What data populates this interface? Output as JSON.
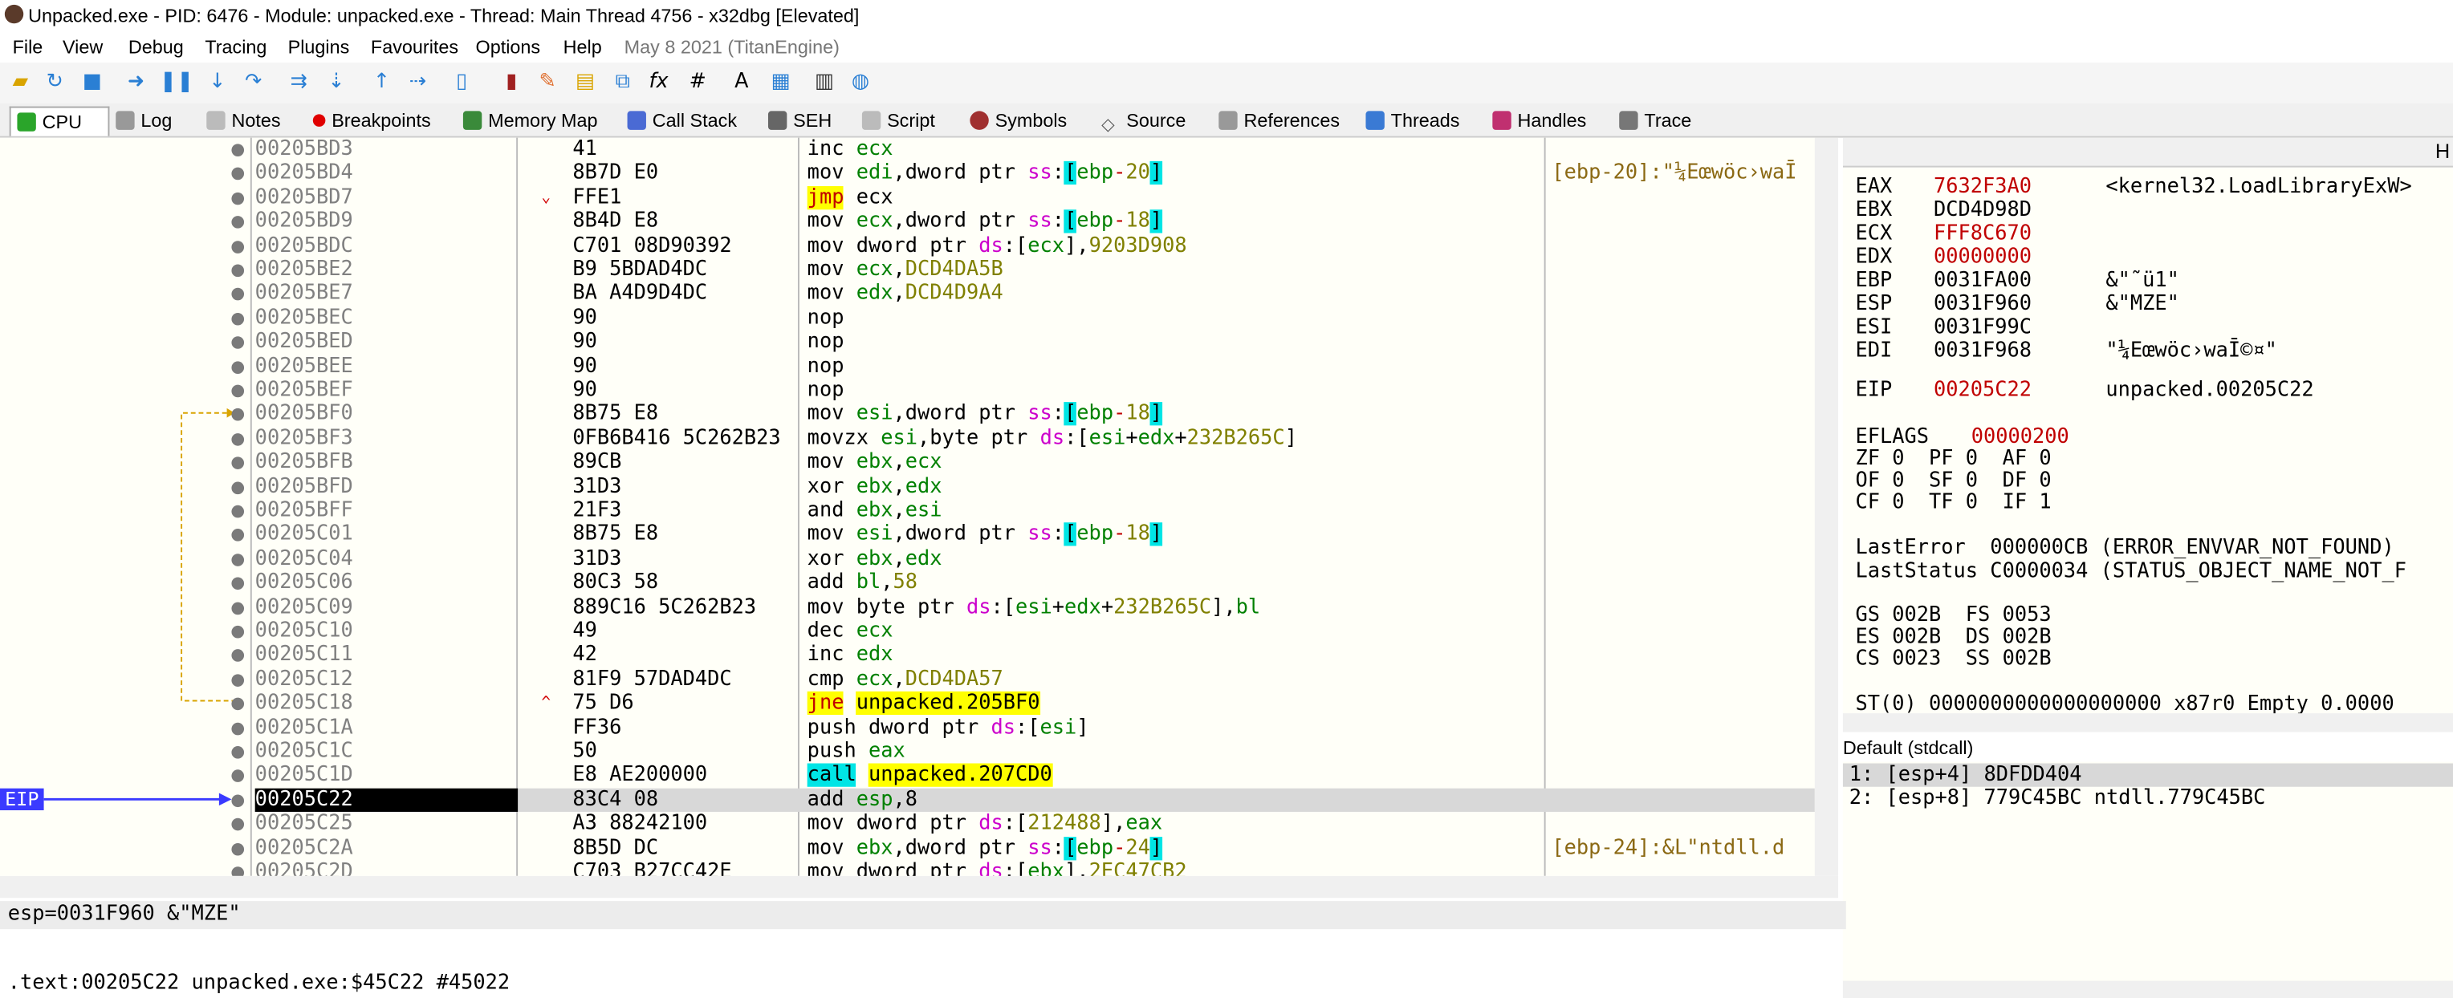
{
  "window": {
    "title": "Unpacked.exe - PID: 6476 - Module: unpacked.exe - Thread: Main Thread 4756 - x32dbg [Elevated]"
  },
  "menu": [
    "File",
    "View",
    "Debug",
    "Tracing",
    "Plugins",
    "Favourites",
    "Options",
    "Help"
  ],
  "menu_date": "May 8 2021 (TitanEngine)",
  "toolbar_icons": [
    "open-icon",
    "restart-icon",
    "stop-icon",
    "run-icon",
    "pause-icon",
    "step-into-icon",
    "step-over-icon",
    "trace-into-icon",
    "trace-over-icon",
    "execute-till-return-icon",
    "run-to-user-code-icon",
    "scylla-icon",
    "patch-icon",
    "comment-icon",
    "label-icon",
    "bookmark-icon",
    "function-icon",
    "hash-icon",
    "font-icon",
    "strings-icon",
    "calculator-icon",
    "web-icon"
  ],
  "tabs": [
    "CPU",
    "Log",
    "Notes",
    "Breakpoints",
    "Memory Map",
    "Call Stack",
    "SEH",
    "Script",
    "Symbols",
    "Source",
    "References",
    "Threads",
    "Handles",
    "Trace"
  ],
  "disasm": [
    {
      "addr": "00205BD3",
      "bytes": "41",
      "instr": "inc ecx",
      "cmt": ""
    },
    {
      "addr": "00205BD4",
      "bytes": "8B7D E0",
      "instr": "mov edi,dword ptr ss:[ebp-20]",
      "cmt": "[ebp-20]:\"¼Eœwöc›waĪ"
    },
    {
      "addr": "00205BD7",
      "bytes": "FFE1",
      "instr": "jmp ecx",
      "cmt": ""
    },
    {
      "addr": "00205BD9",
      "bytes": "8B4D E8",
      "instr": "mov ecx,dword ptr ss:[ebp-18]",
      "cmt": ""
    },
    {
      "addr": "00205BDC",
      "bytes": "C701 08D90392",
      "instr": "mov dword ptr ds:[ecx],9203D908",
      "cmt": ""
    },
    {
      "addr": "00205BE2",
      "bytes": "B9 5BDAD4DC",
      "instr": "mov ecx,DCD4DA5B",
      "cmt": ""
    },
    {
      "addr": "00205BE7",
      "bytes": "BA A4D9D4DC",
      "instr": "mov edx,DCD4D9A4",
      "cmt": ""
    },
    {
      "addr": "00205BEC",
      "bytes": "90",
      "instr": "nop",
      "cmt": ""
    },
    {
      "addr": "00205BED",
      "bytes": "90",
      "instr": "nop",
      "cmt": ""
    },
    {
      "addr": "00205BEE",
      "bytes": "90",
      "instr": "nop",
      "cmt": ""
    },
    {
      "addr": "00205BEF",
      "bytes": "90",
      "instr": "nop",
      "cmt": ""
    },
    {
      "addr": "00205BF0",
      "bytes": "8B75 E8",
      "instr": "mov esi,dword ptr ss:[ebp-18]",
      "cmt": ""
    },
    {
      "addr": "00205BF3",
      "bytes": "0FB6B416 5C262B23",
      "instr": "movzx esi,byte ptr ds:[esi+edx+232B265C]",
      "cmt": ""
    },
    {
      "addr": "00205BFB",
      "bytes": "89CB",
      "instr": "mov ebx,ecx",
      "cmt": ""
    },
    {
      "addr": "00205BFD",
      "bytes": "31D3",
      "instr": "xor ebx,edx",
      "cmt": ""
    },
    {
      "addr": "00205BFF",
      "bytes": "21F3",
      "instr": "and ebx,esi",
      "cmt": ""
    },
    {
      "addr": "00205C01",
      "bytes": "8B75 E8",
      "instr": "mov esi,dword ptr ss:[ebp-18]",
      "cmt": ""
    },
    {
      "addr": "00205C04",
      "bytes": "31D3",
      "instr": "xor ebx,edx",
      "cmt": ""
    },
    {
      "addr": "00205C06",
      "bytes": "80C3 58",
      "instr": "add bl,58",
      "cmt": ""
    },
    {
      "addr": "00205C09",
      "bytes": "889C16 5C262B23",
      "instr": "mov byte ptr ds:[esi+edx+232B265C],bl",
      "cmt": ""
    },
    {
      "addr": "00205C10",
      "bytes": "49",
      "instr": "dec ecx",
      "cmt": ""
    },
    {
      "addr": "00205C11",
      "bytes": "42",
      "instr": "inc edx",
      "cmt": ""
    },
    {
      "addr": "00205C12",
      "bytes": "81F9 57DAD4DC",
      "instr": "cmp ecx,DCD4DA57",
      "cmt": ""
    },
    {
      "addr": "00205C18",
      "bytes": "75 D6",
      "instr": "jne unpacked.205BF0",
      "cmt": ""
    },
    {
      "addr": "00205C1A",
      "bytes": "FF36",
      "instr": "push dword ptr ds:[esi]",
      "cmt": ""
    },
    {
      "addr": "00205C1C",
      "bytes": "50",
      "instr": "push eax",
      "cmt": ""
    },
    {
      "addr": "00205C1D",
      "bytes": "E8 AE200000",
      "instr": "call unpacked.207CD0",
      "cmt": ""
    },
    {
      "addr": "00205C22",
      "bytes": "83C4 08",
      "instr": "add esp,8",
      "cmt": ""
    },
    {
      "addr": "00205C25",
      "bytes": "A3 88242100",
      "instr": "mov dword ptr ds:[212488],eax",
      "cmt": ""
    },
    {
      "addr": "00205C2A",
      "bytes": "8B5D DC",
      "instr": "mov ebx,dword ptr ss:[ebp-24]",
      "cmt": "[ebp-24]:&L\"ntdll.d"
    },
    {
      "addr": "00205C2D",
      "bytes": "C703 B27CC42E",
      "instr": "mov dword ptr ds:[ebx],2EC47CB2",
      "cmt": ""
    }
  ],
  "eip_label": "EIP",
  "registers": {
    "header": "H",
    "gpr": [
      {
        "name": "EAX",
        "val": "7632F3A0",
        "info": "<kernel32.LoadLibraryExW>",
        "changed": true
      },
      {
        "name": "EBX",
        "val": "DCD4D98D",
        "info": "",
        "changed": false
      },
      {
        "name": "ECX",
        "val": "FFF8C670",
        "info": "",
        "changed": true
      },
      {
        "name": "EDX",
        "val": "00000000",
        "info": "",
        "changed": true
      },
      {
        "name": "EBP",
        "val": "0031FA00",
        "info": "&\"˜ü1\"",
        "changed": false
      },
      {
        "name": "ESP",
        "val": "0031F960",
        "info": "&\"MZE\"",
        "changed": false
      },
      {
        "name": "ESI",
        "val": "0031F99C",
        "info": "",
        "changed": false
      },
      {
        "name": "EDI",
        "val": "0031F968",
        "info": "\"¼Eœwöc›waĪ©¤\"",
        "changed": false
      }
    ],
    "eip": {
      "name": "EIP",
      "val": "00205C22",
      "info": "unpacked.00205C22"
    },
    "eflags": {
      "name": "EFLAGS",
      "val": "00000200"
    },
    "flags_rows": [
      "ZF 0  PF 0  AF 0",
      "OF 0  SF 0  DF 0",
      "CF 0  TF 0  IF 1"
    ],
    "last_error": "LastError  000000CB (ERROR_ENVVAR_NOT_FOUND)",
    "last_status": "LastStatus C0000034 (STATUS_OBJECT_NAME_NOT_F",
    "segs": [
      "GS 002B  FS 0053",
      "ES 002B  DS 002B",
      "CS 0023  SS 002B"
    ],
    "st0": "ST(0) 0000000000000000000 x87r0 Empty 0.0000"
  },
  "callconv": "Default (stdcall)",
  "callargs": [
    "1: [esp+4] 8DFDD404",
    "2: [esp+8] 779C45BC ntdll.779C45BC"
  ],
  "infobar": "esp=0031F960 &\"MZE\"",
  "addrbar": ".text:00205C22 unpacked.exe:$45C22 #45022",
  "colors": {
    "eip_marker": "#3a3aff",
    "changed_reg": "#c00000",
    "jump_highlight": "#ffff00",
    "call_highlight": "#00e5e5"
  }
}
